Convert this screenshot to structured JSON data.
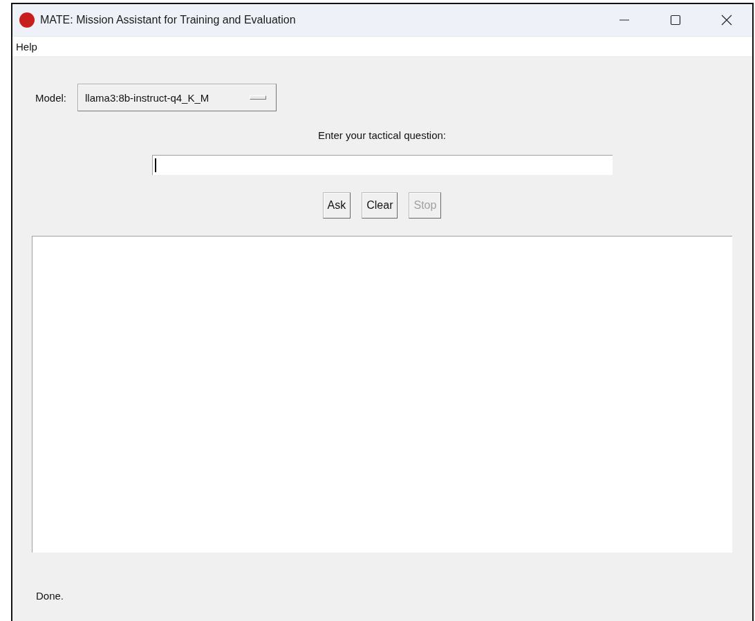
{
  "window": {
    "title": "MATE: Mission Assistant for Training and Evaluation"
  },
  "menu": [
    {
      "label": "Help"
    }
  ],
  "model": {
    "label": "Model:",
    "value": "llama3:8b-instruct-q4_K_M"
  },
  "question": {
    "label": "Enter your tactical question:",
    "focused": true
  },
  "buttons": [
    {
      "label": "Ask",
      "disabled": false
    },
    {
      "label": "Clear",
      "disabled": false
    },
    {
      "label": "Stop",
      "disabled": true
    }
  ],
  "status": "Done."
}
